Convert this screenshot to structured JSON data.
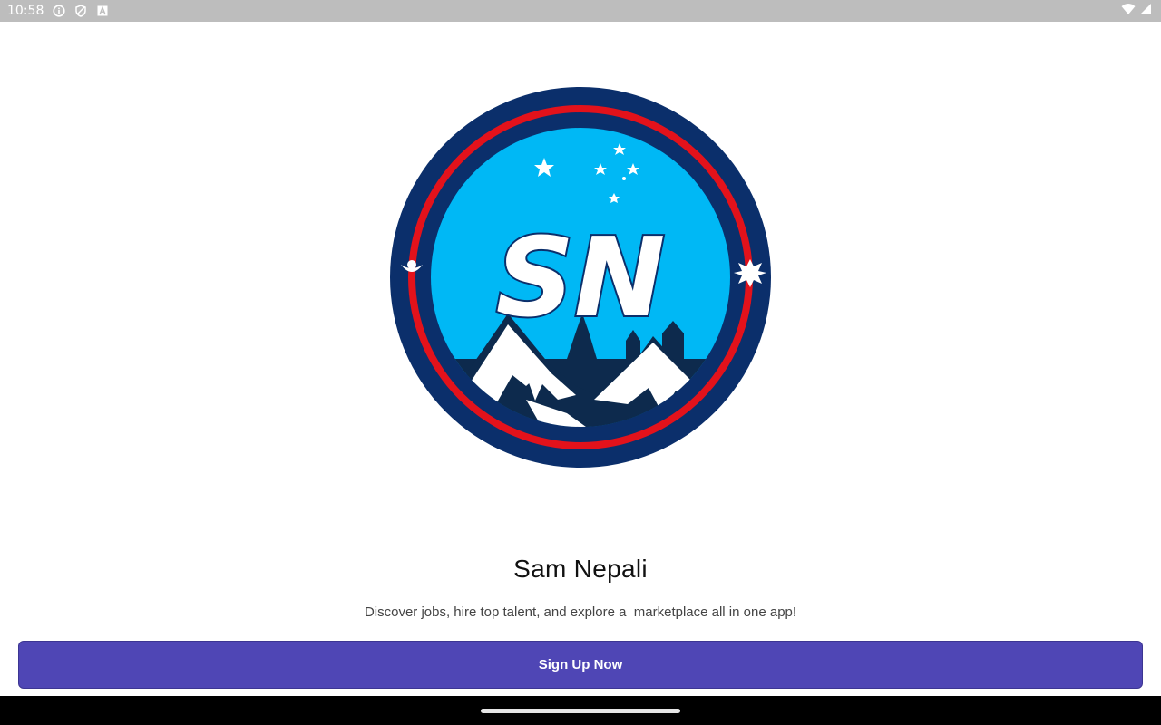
{
  "status_bar": {
    "time": "10:58",
    "icons": [
      "info-icon",
      "shield-icon",
      "font-a-icon",
      "wifi-icon",
      "signal-icon"
    ]
  },
  "logo": {
    "alt": "Sam Nepali logo",
    "monogram": "SN",
    "colors": {
      "outer_ring": "#0b2f6b",
      "red_ring": "#e3121b",
      "sky": "#00b8f5",
      "mountain_shadow": "#0d2a4d",
      "snow": "#ffffff"
    }
  },
  "app": {
    "title": "Sam Nepali",
    "tagline": "Discover jobs, hire top talent, and explore a  marketplace all in one app!"
  },
  "actions": {
    "signup_label": "Sign Up Now"
  },
  "colors": {
    "primary": "#4f46b5",
    "status_bar": "#bdbdbd"
  }
}
